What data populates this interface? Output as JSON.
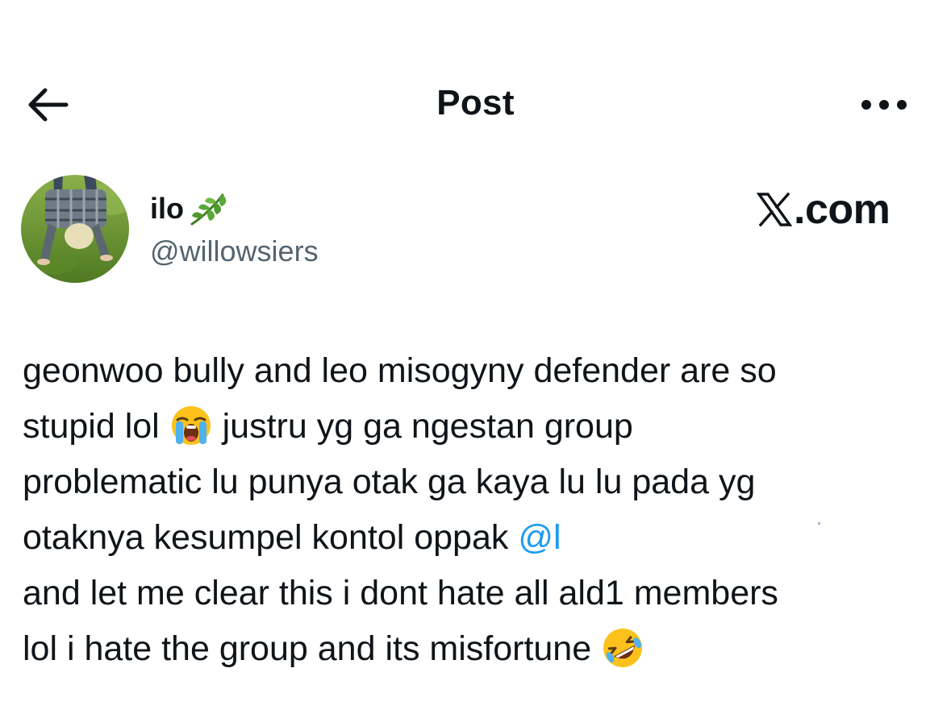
{
  "header": {
    "title": "Post",
    "back_icon": "arrow-left-icon",
    "more_icon": "more-horizontal-icon"
  },
  "author": {
    "display_name": "ilo",
    "name_emoji": "herb-icon",
    "handle": "@willowsiers",
    "avatar": "avatar-photo"
  },
  "watermark": {
    "text": ".com",
    "logo": "x-logo-icon"
  },
  "post": {
    "line1": "geonwoo bully and leo misogyny defender are so",
    "line2_a": "stupid lol",
    "line2_emoji": "loudly-crying-face-icon",
    "line2_b": "justru yg ga ngestan group",
    "line3": "problematic lu punya otak ga kaya lu lu pada yg",
    "line4_a": "otaknya kesumpel kontol oppak",
    "line4_mention": "@l",
    "line5": "and let me clear this i dont hate all ald1 members",
    "line6_a": "lol i hate the group and its misfortune",
    "line6_emoji": "rolling-on-floor-laughing-icon"
  },
  "colors": {
    "text": "#0f1419",
    "secondary": "#536471",
    "link": "#1d9bf0",
    "background": "#ffffff"
  }
}
